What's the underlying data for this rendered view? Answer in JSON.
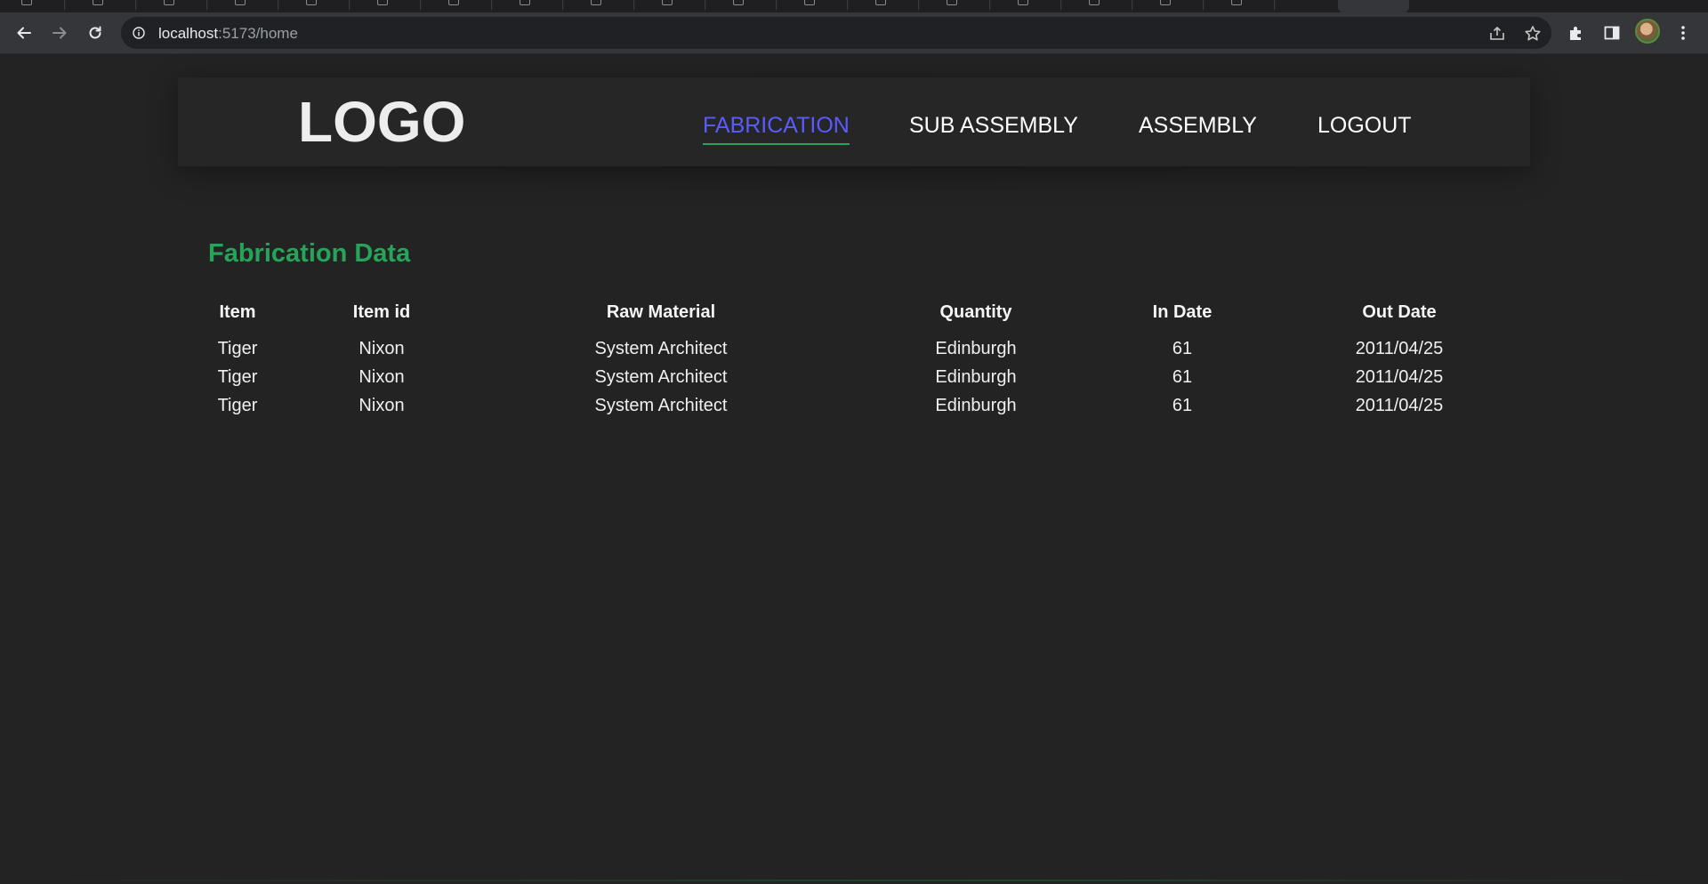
{
  "browser": {
    "url_host": "localhost",
    "url_rest": ":5173/home"
  },
  "header": {
    "logo": "LOGO",
    "nav": [
      {
        "label": "FABRICATION",
        "active": true
      },
      {
        "label": "SUB ASSEMBLY",
        "active": false
      },
      {
        "label": "ASSEMBLY",
        "active": false
      },
      {
        "label": "LOGOUT",
        "active": false
      }
    ]
  },
  "main": {
    "title": "Fabrication Data",
    "table": {
      "columns": [
        "Item",
        "Item id",
        "Raw Material",
        "Quantity",
        "In Date",
        "Out Date"
      ],
      "rows": [
        [
          "Tiger",
          "Nixon",
          "System Architect",
          "Edinburgh",
          "61",
          "2011/04/25"
        ],
        [
          "Tiger",
          "Nixon",
          "System Architect",
          "Edinburgh",
          "61",
          "2011/04/25"
        ],
        [
          "Tiger",
          "Nixon",
          "System Architect",
          "Edinburgh",
          "61",
          "2011/04/25"
        ]
      ]
    }
  },
  "colors": {
    "background": "#232323",
    "header_bg": "#262626",
    "accent_green": "#27a35a",
    "active_nav": "#5a5aff",
    "text": "#f0f0f0"
  }
}
